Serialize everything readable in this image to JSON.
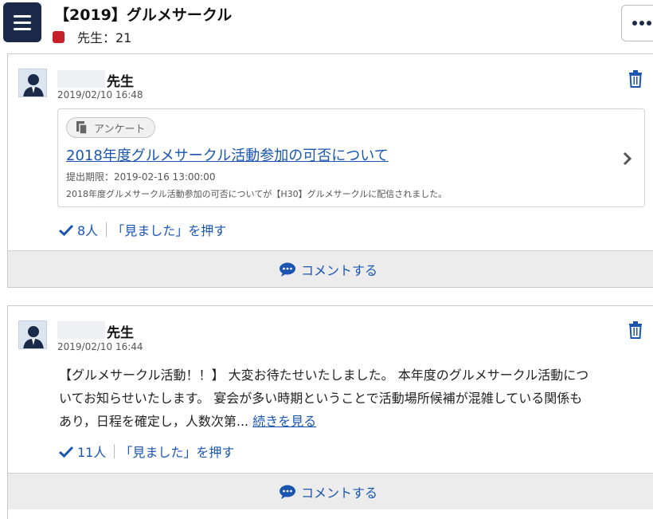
{
  "header": {
    "title": "【2019】グルメサークル",
    "teacher_count": "先生：21"
  },
  "posts": [
    {
      "author_suffix": "先生",
      "timestamp": "2019/02/10 16:48",
      "survey": {
        "tag": "アンケート",
        "title": "2018年度グルメサークル活動参加の可否について",
        "deadline": "提出期限：2019-02-16 13:00:00",
        "description": "2018年度グルメサークル活動参加の可否についてが【H30】グルメサークルに配信されました。"
      },
      "seen_count": "8人",
      "seen_action": "「見ました」を押す",
      "comment_label": "コメントする"
    },
    {
      "author_suffix": "先生",
      "timestamp": "2019/02/10 16:44",
      "body_line1": "【グルメサークル活動！！】 大変お待たせいたしました。 本年度のグルメサークル活動につ",
      "body_line2": "いてお知らせいたします。 宴会が多い時期ということで活動場所候補が混雑している関係も",
      "body_line3": "あり，日程を確定し，人数次第... ",
      "read_more": "続きを見る",
      "seen_count": "11人",
      "seen_action": "「見ました」を押す",
      "comment_label": "コメントする"
    }
  ],
  "colors": {
    "navy": "#1c2a4a",
    "link_blue": "#1a56b0",
    "badge_red": "#c8202a"
  },
  "icons": [
    "menu-icon",
    "more-icon",
    "avatar-icon",
    "trash-icon",
    "survey-icon",
    "chevron-right-icon",
    "check-icon",
    "comment-icon"
  ]
}
